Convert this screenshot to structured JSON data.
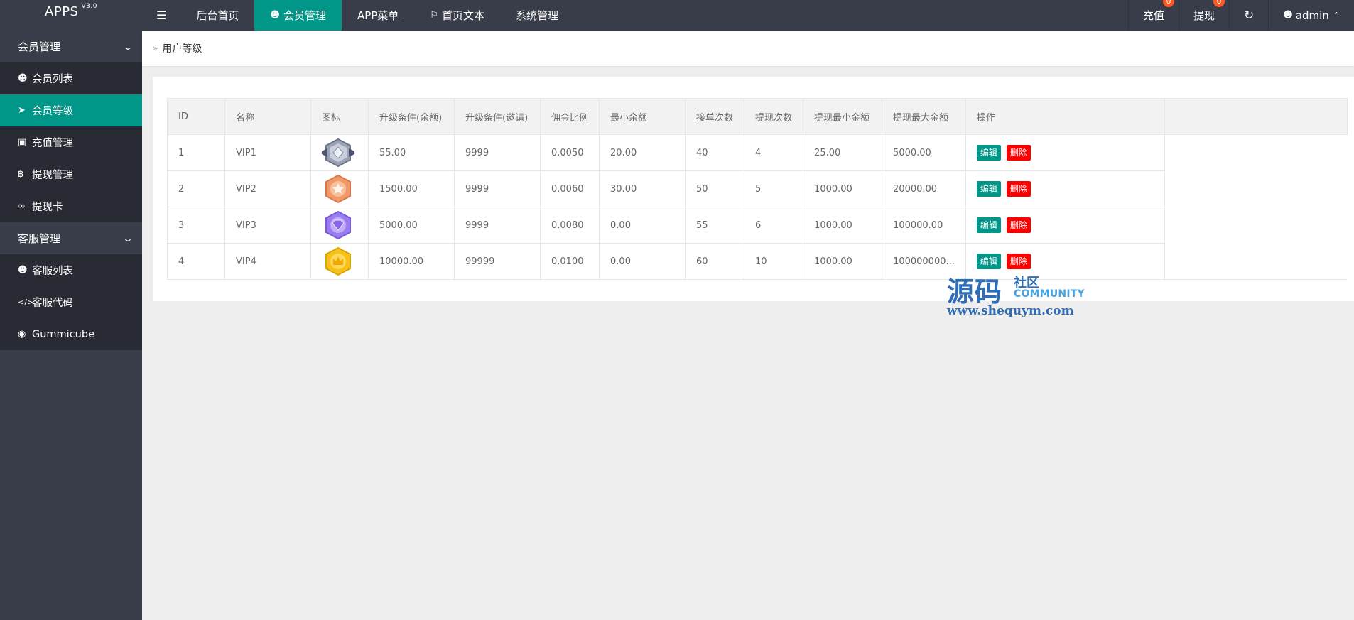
{
  "header": {
    "logo": "APPS",
    "version": "V3.0",
    "nav": [
      {
        "label": "后台首页",
        "icon": ""
      },
      {
        "label": "会员管理",
        "icon": "user-icon"
      },
      {
        "label": "APP菜单",
        "icon": ""
      },
      {
        "label": "首页文本",
        "icon": "flag-icon"
      },
      {
        "label": "系统管理",
        "icon": ""
      }
    ],
    "active_nav": 1,
    "recharge_label": "充值",
    "recharge_badge": "0",
    "withdraw_label": "提现",
    "withdraw_badge": "0",
    "refresh_icon": "refresh-icon",
    "user_label": "admin"
  },
  "sidebar": {
    "groups": [
      {
        "label": "会员管理",
        "items": [
          {
            "label": "会员列表",
            "icon": "user-icon"
          },
          {
            "label": "会员等级",
            "icon": "rocket-icon"
          },
          {
            "label": "充值管理",
            "icon": "recharge-icon"
          },
          {
            "label": "提现管理",
            "icon": "bitcoin-icon"
          },
          {
            "label": "提现卡",
            "icon": "link-icon"
          }
        ]
      },
      {
        "label": "客服管理",
        "items": [
          {
            "label": "客服列表",
            "icon": "users-icon"
          },
          {
            "label": "客服代码",
            "icon": "code-icon"
          },
          {
            "label": "Gummicube",
            "icon": "gummicube-icon"
          }
        ]
      }
    ]
  },
  "breadcrumb": "用户等级",
  "table": {
    "headers": [
      "ID",
      "名称",
      "图标",
      "升级条件(余额)",
      "升级条件(邀请)",
      "佣金比例",
      "最小余额",
      "接单次数",
      "提现次数",
      "提现最小金额",
      "提现最大金额",
      "操作"
    ],
    "rows": [
      {
        "id": "1",
        "name": "VIP1",
        "medal": "silver-medal-icon",
        "up_balance": "55.00",
        "up_invite": "9999",
        "ratio": "0.0050",
        "min_balance": "20.00",
        "orders": "40",
        "withdraw_count": "4",
        "withdraw_min": "25.00",
        "withdraw_max": "5000.00"
      },
      {
        "id": "2",
        "name": "VIP2",
        "medal": "bronze-medal-icon",
        "up_balance": "1500.00",
        "up_invite": "9999",
        "ratio": "0.0060",
        "min_balance": "30.00",
        "orders": "50",
        "withdraw_count": "5",
        "withdraw_min": "1000.00",
        "withdraw_max": "20000.00"
      },
      {
        "id": "3",
        "name": "VIP3",
        "medal": "purple-medal-icon",
        "up_balance": "5000.00",
        "up_invite": "9999",
        "ratio": "0.0080",
        "min_balance": "0.00",
        "orders": "55",
        "withdraw_count": "6",
        "withdraw_min": "1000.00",
        "withdraw_max": "100000.00"
      },
      {
        "id": "4",
        "name": "VIP4",
        "medal": "gold-medal-icon",
        "up_balance": "10000.00",
        "up_invite": "99999",
        "ratio": "0.0100",
        "min_balance": "0.00",
        "orders": "60",
        "withdraw_count": "10",
        "withdraw_min": "1000.00",
        "withdraw_max": "100000000..."
      }
    ],
    "edit_label": "编辑",
    "delete_label": "删除"
  },
  "watermark": {
    "big": "源码",
    "small1": "社区",
    "small2": "COMMUNITY",
    "url": "www.shequym.com"
  },
  "colors": {
    "header_bg": "#393d49",
    "accent": "#009688",
    "danger": "#ff0000",
    "badge": "#ff5722"
  }
}
